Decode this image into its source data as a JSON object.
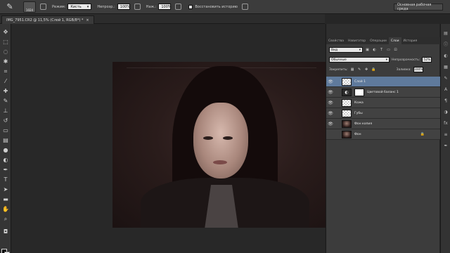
{
  "options_bar": {
    "brush_size": "1024",
    "mode_label": "Режим:",
    "mode_value": "Кисть",
    "opacity_label": "Непрозр.:",
    "opacity_value": "100%",
    "flow_label": "Наж.:",
    "flow_value": "100%",
    "restore_history_label": "Восстановить историю",
    "workspace": "Основная рабочая среда"
  },
  "document_tab": {
    "title": "IMG_7951.CR2 @ 11,5% (Слой 1, RGB/8*) *",
    "close": "×"
  },
  "panel": {
    "tabs": [
      "Свойства",
      "Навигатор",
      "Операции",
      "Слои",
      "История"
    ],
    "active_tab": "Слои",
    "filter_label": "Вид",
    "blend_mode": "Обычные",
    "opacity_label": "Непрозрачность:",
    "opacity_value": "52%",
    "lock_label": "Закрепить:",
    "fill_label": "Заливка:",
    "fill_value": "100%",
    "layers": [
      {
        "name": "Слой 1",
        "thumb": "check",
        "selected": true,
        "visible": true,
        "locked": false
      },
      {
        "name": "Цветовой баланс 1",
        "thumb": "adjust",
        "selected": false,
        "visible": true,
        "locked": false
      },
      {
        "name": "Кожа",
        "thumb": "check",
        "selected": false,
        "visible": true,
        "locked": false
      },
      {
        "name": "Губы",
        "thumb": "check",
        "selected": false,
        "visible": true,
        "locked": false
      },
      {
        "name": "Фон копия",
        "thumb": "photo",
        "selected": false,
        "visible": true,
        "locked": false
      },
      {
        "name": "Фон",
        "thumb": "photo",
        "selected": false,
        "visible": false,
        "locked": true
      }
    ]
  },
  "colors": {
    "selected_layer": "#5f7a9c",
    "panel_bg": "#3c3c3c",
    "workspace_bg": "#282828"
  }
}
